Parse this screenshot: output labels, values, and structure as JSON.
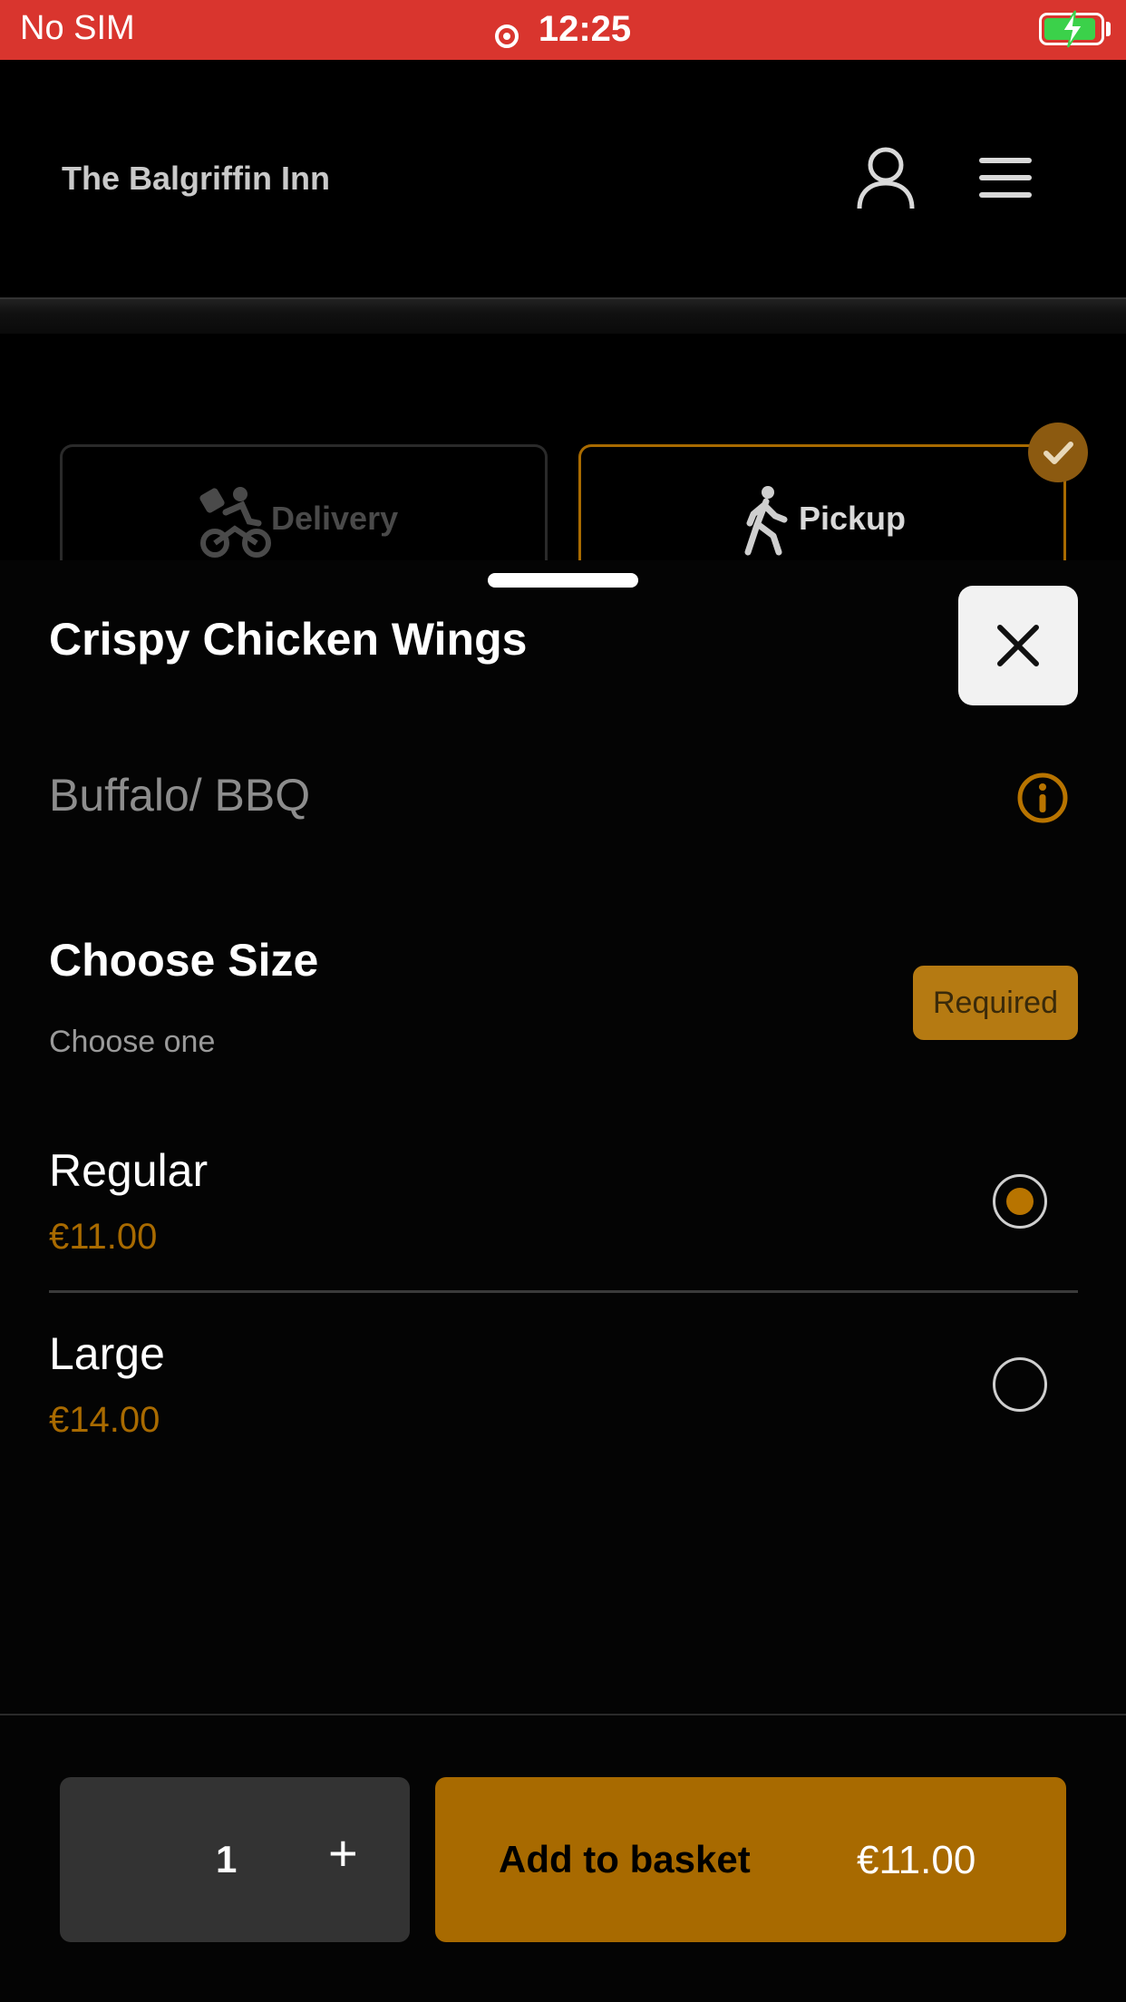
{
  "status_bar": {
    "carrier": "No SIM",
    "time": "12:25",
    "battery_color": "#3bd14a"
  },
  "header": {
    "brand": "The Balgriffin Inn",
    "account_icon": "person-icon",
    "menu_icon": "hamburger-menu-icon"
  },
  "order_mode": {
    "tabs": [
      {
        "label": "Delivery",
        "icon": "cyclist-delivery-icon",
        "selected": false
      },
      {
        "label": "Pickup",
        "icon": "walking-person-icon",
        "selected": true
      }
    ]
  },
  "item": {
    "title": "Crispy Chicken Wings",
    "description": "Buffalo/ BBQ"
  },
  "size_section": {
    "title": "Choose Size",
    "subtitle": "Choose one",
    "badge": "Required",
    "options": [
      {
        "name": "Regular",
        "price": "€11.00",
        "selected": true
      },
      {
        "name": "Large",
        "price": "€14.00",
        "selected": false
      }
    ]
  },
  "footer": {
    "quantity": "1",
    "plus": "+",
    "add_label": "Add to basket",
    "total": "€11.00"
  },
  "colors": {
    "accent": "#a86a00",
    "status_bar": "#d9352e"
  }
}
